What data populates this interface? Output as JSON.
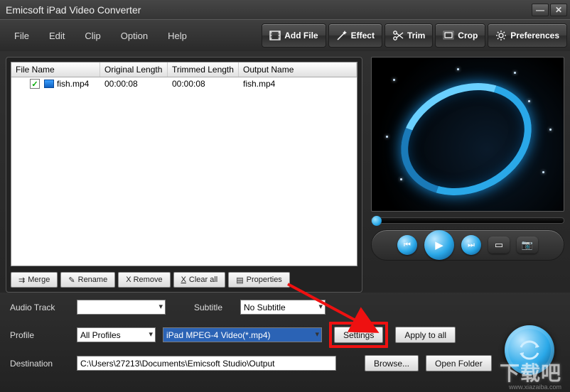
{
  "title": "Emicsoft iPad Video Converter",
  "menu": {
    "file": "File",
    "edit": "Edit",
    "clip": "Clip",
    "option": "Option",
    "help": "Help"
  },
  "toolbar": {
    "addfile": "Add File",
    "effect": "Effect",
    "trim": "Trim",
    "crop": "Crop",
    "prefs": "Preferences"
  },
  "columns": {
    "name": "File Name",
    "orig": "Original Length",
    "trim": "Trimmed Length",
    "out": "Output Name"
  },
  "files": [
    {
      "name": "fish.mp4",
      "orig": "00:00:08",
      "trim": "00:00:08",
      "out": "fish.mp4",
      "checked": true
    }
  ],
  "actions": {
    "merge": "Merge",
    "rename": "Rename",
    "remove": "X Remove",
    "clear": "Clear all",
    "props": "Properties"
  },
  "bottom": {
    "audioTrackLabel": "Audio Track",
    "audioTrack": "",
    "subtitleLabel": "Subtitle",
    "subtitle": "No Subtitle",
    "profileLabel": "Profile",
    "profileGroup": "All Profiles",
    "profile": "iPad MPEG-4 Video(*.mp4)",
    "settings": "Settings",
    "applyAll": "Apply to all",
    "destLabel": "Destination",
    "dest": "C:\\Users\\27213\\Documents\\Emicsoft Studio\\Output",
    "browse": "Browse...",
    "openFolder": "Open Folder"
  },
  "watermark": "下载吧",
  "watermark_url": "www.xiazaiba.com"
}
